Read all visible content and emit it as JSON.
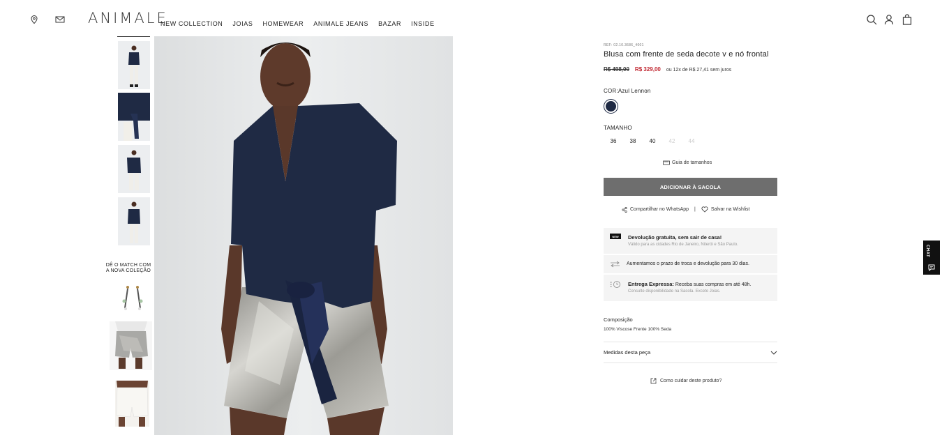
{
  "brand": {
    "logo": "ANIMALE"
  },
  "nav": [
    "NEW COLLECTION",
    "JOIAS",
    "HOMEWEAR",
    "ANIMALE JEANS",
    "BAZAR",
    "INSIDE"
  ],
  "gallery": {
    "match_label_line1": "DÊ O MATCH COM",
    "match_label_line2": "A NOVA COLEÇÃO"
  },
  "product": {
    "ref": "REF: 02.10.3686_4001",
    "title": "Blusa com frente de seda decote v e nó frontal",
    "old_price": "R$ 498,00",
    "new_price": "R$ 329,00",
    "installments": "ou 12x de R$ 27,41 sem juros",
    "color_label": "COR:",
    "color_value": "Azul Lennon",
    "swatch_color": "#1f2a44",
    "size_label": "TAMANHO",
    "sizes": [
      {
        "label": "36",
        "available": true
      },
      {
        "label": "38",
        "available": true
      },
      {
        "label": "40",
        "available": true
      },
      {
        "label": "42",
        "available": false
      },
      {
        "label": "44",
        "available": false
      }
    ],
    "size_guide": "Guia de tamanhos",
    "add_to_bag": "ADICIONAR À SACOLA",
    "share_whatsapp": "Compartilhar no WhatsApp",
    "separator": "|",
    "save_wishlist": "Salvar na Wishlist"
  },
  "info": {
    "badge": "NEW",
    "return_title": "Devolução gratuita, sem sair de casa!",
    "return_sub": "Válido para as cidades Rio de Janeiro, Niterói e São Paulo.",
    "exchange": "Aumentamos o prazo de troca e devolução para 30 dias.",
    "express_title": "Entrega Expressa:",
    "express_text": "Receba suas compras em até 48h.",
    "express_sub": "Consulte disponibilidade na Sacola. Exceto Joias."
  },
  "composition": {
    "label": "Composição",
    "value": "100% Viscose Frente 100% Seda"
  },
  "measures_label": "Medidas desta peça",
  "care_link": "Como cuidar deste produto?",
  "chat_label": "CHAT"
}
